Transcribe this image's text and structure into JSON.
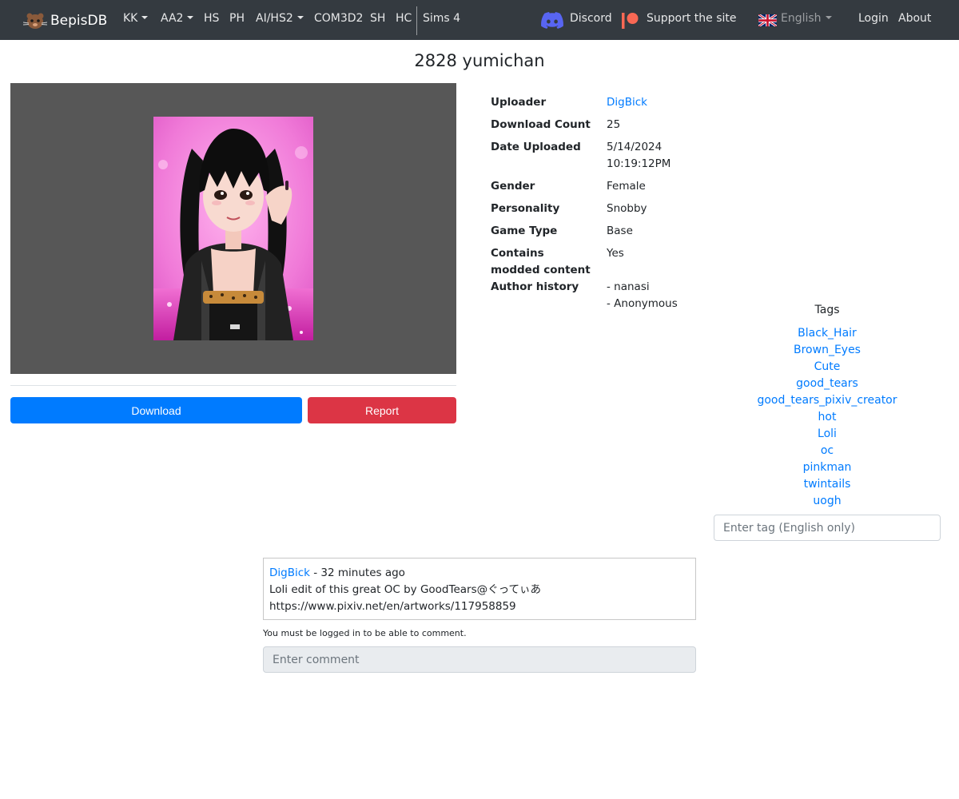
{
  "navbar": {
    "brand": "BepisDB",
    "items": [
      {
        "label": "KK"
      },
      {
        "label": "AA2"
      },
      {
        "label": "HS"
      },
      {
        "label": "PH"
      },
      {
        "label": "AI/HS2"
      },
      {
        "label": "COM3D2"
      },
      {
        "label": "SH"
      },
      {
        "label": "HC"
      },
      {
        "label": "Sims 4"
      }
    ],
    "discord": "Discord",
    "support": "Support the site",
    "language": "English",
    "login": "Login",
    "about": "About"
  },
  "page": {
    "title": "2828 yumichan"
  },
  "preview": {
    "bg_color": "#575757"
  },
  "actions": {
    "download": "Download",
    "report": "Report"
  },
  "info": {
    "uploader_label": "Uploader",
    "uploader_value": "DigBick",
    "download_count_label": "Download Count",
    "download_count_value": "25",
    "date_label": "Date Uploaded",
    "date_value_line1": "5/14/2024",
    "date_value_line2": "10:19:12PM",
    "gender_label": "Gender",
    "gender_value": "Female",
    "personality_label": "Personality",
    "personality_value": "Snobby",
    "game_type_label": "Game Type",
    "game_type_value": "Base",
    "modded_label_line1": "Contains",
    "modded_label_line2": "modded content",
    "modded_value": "Yes",
    "author_history_label": "Author history",
    "author_history": [
      "- nanasi",
      "- Anonymous"
    ]
  },
  "tags": {
    "title": "Tags",
    "items": [
      "Black_Hair",
      "Brown_Eyes",
      "Cute",
      "good_tears",
      "good_tears_pixiv_creator",
      "hot",
      "Loli",
      "oc",
      "pinkman",
      "twintails",
      "uogh"
    ],
    "input_placeholder": "Enter tag (English only)"
  },
  "comments": {
    "items": [
      {
        "author": "DigBick",
        "time": " - 32 minutes ago",
        "line1": "Loli edit of this great OC by GoodTears@ぐってぃあ",
        "line2": "https://www.pixiv.net/en/artworks/117958859"
      }
    ],
    "login_note": "You must be logged in to be able to comment.",
    "input_placeholder": "Enter comment"
  },
  "colors": {
    "navbar": "#343a40",
    "link": "#007bff",
    "download": "#007bff",
    "report": "#dc3545"
  }
}
